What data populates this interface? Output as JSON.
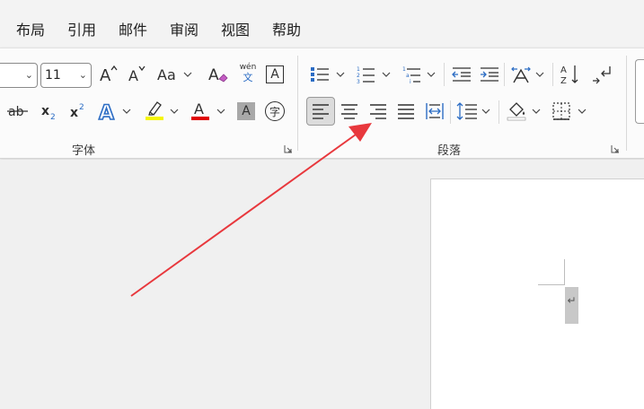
{
  "menu": {
    "items": [
      "布局",
      "引用",
      "邮件",
      "审阅",
      "视图",
      "帮助"
    ]
  },
  "font_group": {
    "font_size_value": "11",
    "grow_icon": "A",
    "shrink_icon": "A",
    "case_label": "Aa",
    "phonetic_top": "wén",
    "phonetic_bottom": "文",
    "border_char_label": "A",
    "strikethrough_label": "ab",
    "subscript_label": "x",
    "superscript_label": "x",
    "text_effect_label": "A",
    "font_color_label": "A",
    "char_shading_label": "A",
    "enclose_char_label": "字",
    "group_label": "字体",
    "highlight_color": "#f5f500",
    "font_color": "#e00000"
  },
  "paragraph_group": {
    "group_label": "段落",
    "para_mark": "↵"
  },
  "colors": {
    "arrow": "#e8383d"
  }
}
